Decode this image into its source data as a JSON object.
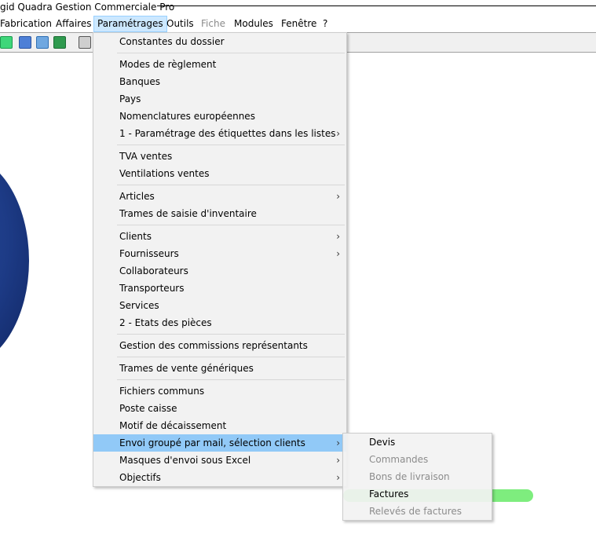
{
  "window": {
    "title": "gid Quadra Gestion Commerciale Pro"
  },
  "menubar": {
    "items": [
      {
        "label": "Fabrication",
        "state": "normal"
      },
      {
        "label": "Affaires",
        "state": "normal"
      },
      {
        "label": "Paramétrages",
        "state": "active"
      },
      {
        "label": "Outils",
        "state": "normal"
      },
      {
        "label": "Fiche",
        "state": "disabled"
      },
      {
        "label": "Modules",
        "state": "normal"
      },
      {
        "label": "Fenêtre",
        "state": "normal"
      },
      {
        "label": "?",
        "state": "normal"
      }
    ]
  },
  "toolbar": {
    "icons": [
      "green-c-icon",
      "document-icon",
      "chart-icon",
      "excel-icon",
      "print-icon"
    ]
  },
  "parametrages_menu": {
    "items": [
      {
        "label": "Constantes du dossier"
      },
      {
        "label": "Modes de règlement"
      },
      {
        "label": "Banques"
      },
      {
        "label": "Pays"
      },
      {
        "label": "Nomenclatures européennes"
      },
      {
        "label": "1 - Paramétrage des étiquettes dans les listes",
        "has_submenu": true
      },
      {
        "label": "TVA ventes"
      },
      {
        "label": "Ventilations ventes"
      },
      {
        "label": "Articles",
        "has_submenu": true
      },
      {
        "label": "Trames de saisie d'inventaire"
      },
      {
        "label": "Clients",
        "has_submenu": true
      },
      {
        "label": "Fournisseurs",
        "has_submenu": true
      },
      {
        "label": "Collaborateurs"
      },
      {
        "label": "Transporteurs"
      },
      {
        "label": "Services"
      },
      {
        "label": "2 - Etats des pièces"
      },
      {
        "label": "Gestion des commissions représentants"
      },
      {
        "label": "Trames de vente génériques"
      },
      {
        "label": "Fichiers communs"
      },
      {
        "label": "Poste caisse"
      },
      {
        "label": "Motif de décaissement"
      },
      {
        "label": "Envoi groupé par mail, sélection clients",
        "has_submenu": true,
        "highlighted": true
      },
      {
        "label": "Masques d'envoi sous Excel",
        "has_submenu": true
      },
      {
        "label": "Objectifs",
        "has_submenu": true
      }
    ],
    "submenu_arrow": "›"
  },
  "envoi_submenu": {
    "items": [
      {
        "label": "Devis",
        "enabled": true
      },
      {
        "label": "Commandes",
        "enabled": false
      },
      {
        "label": "Bons de livraison",
        "enabled": false
      },
      {
        "label": "Factures",
        "enabled": true,
        "marked": true
      },
      {
        "label": "Relevés de factures",
        "enabled": false
      }
    ],
    "marker_color": "#5ee85e"
  }
}
